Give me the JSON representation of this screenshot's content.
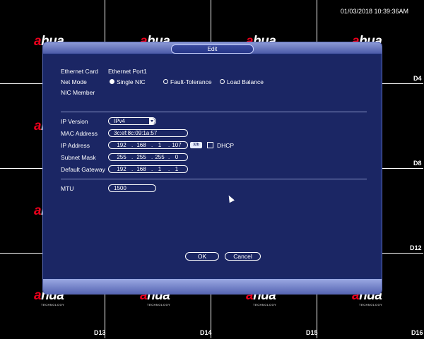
{
  "clock": "01/03/2018 10:39:36AM",
  "brand": {
    "text_red": "a",
    "text_white": "hua",
    "tagline": "TECHNOLOGY"
  },
  "channels": [
    "D4",
    "D8",
    "D12",
    "D13",
    "D14",
    "D15",
    "D16"
  ],
  "dialog": {
    "title": "Edit",
    "ethernet_card_label": "Ethernet Card",
    "ethernet_card_value": "Ethernet Port1",
    "net_mode_label": "Net Mode",
    "net_mode_options": [
      "Single NIC",
      "Fault-Tolerance",
      "Load Balance"
    ],
    "net_mode_selected": "Single NIC",
    "nic_member_label": "NIC Member",
    "ip_version_label": "IP Version",
    "ip_version_value": "IPv4",
    "mac_label": "MAC Address",
    "mac_value": "3c:ef:8c:09:1a:57",
    "ip_label": "IP Address",
    "ip_value": [
      "192",
      "168",
      "1",
      "107"
    ],
    "ip_dhcp_button": "32b",
    "dhcp_label": "DHCP",
    "dhcp_checked": false,
    "subnet_label": "Subnet Mask",
    "subnet_value": [
      "255",
      "255",
      "255",
      "0"
    ],
    "gateway_label": "Default Gateway",
    "gateway_value": [
      "192",
      "168",
      "1",
      "1"
    ],
    "mtu_label": "MTU",
    "mtu_value": "1500",
    "ok_label": "OK",
    "cancel_label": "Cancel"
  }
}
